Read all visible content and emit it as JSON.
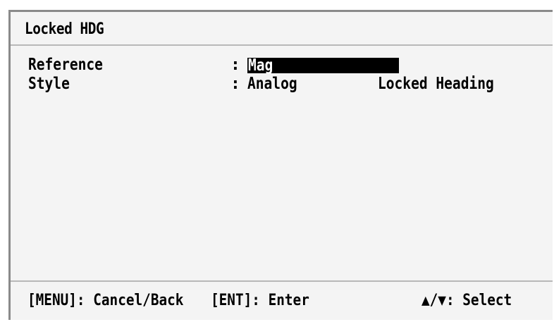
{
  "header": {
    "title": "Locked HDG"
  },
  "menu": {
    "items": [
      {
        "label": "Reference",
        "colon": ":",
        "value": "Mag",
        "selected": true
      },
      {
        "label": "Style",
        "colon": ":",
        "value": "Analog",
        "extra": "Locked Heading",
        "selected": false
      }
    ]
  },
  "footer": {
    "menu_hint": "[MENU]: Cancel/Back",
    "enter_hint": "[ENT]: Enter",
    "select_hint": "▲/▼: Select"
  }
}
